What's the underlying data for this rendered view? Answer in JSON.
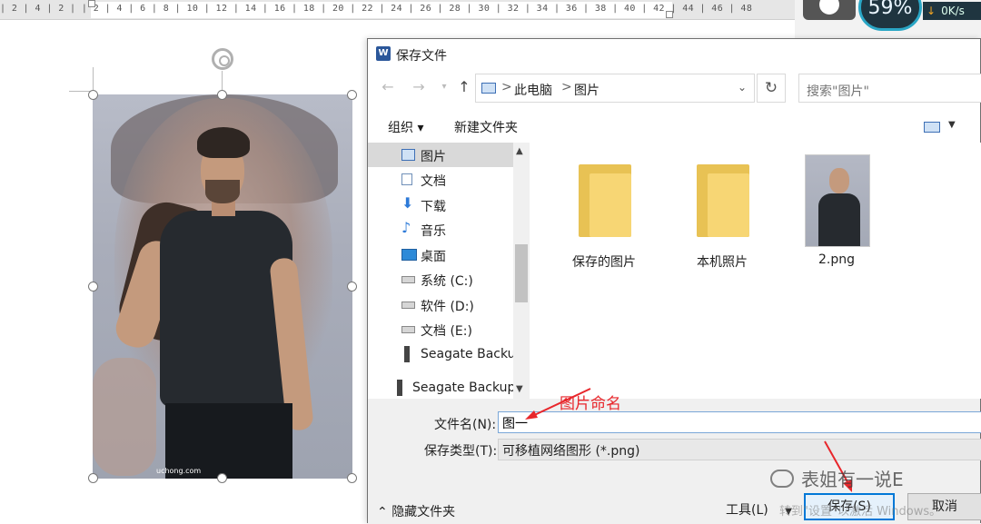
{
  "ruler": {
    "ticks": "| 2 | 4 | 2 | | 2 | 4 | 6 | 8 | 10 | 12 | 14 | 16 | 18 | 20 | 22 | 24 | 26 | 28 | 30 | 32 | 34 | 36 | 38 | 40 | 42 | 44 | 46 | 48"
  },
  "system_widget": {
    "percent": "59%",
    "speed": "0K/s"
  },
  "document": {
    "photo_credit": "uchong.com"
  },
  "dialog": {
    "title": "保存文件",
    "app_icon": "W",
    "address": {
      "segments": [
        "此电脑",
        "图片"
      ],
      "separator": ">"
    },
    "search_placeholder": "搜索\"图片\"",
    "toolbar": {
      "organize": "组织 ▾",
      "new_folder": "新建文件夹"
    },
    "nav_items": [
      {
        "label": "图片",
        "icon": "pictures-icon",
        "selected": true
      },
      {
        "label": "文档",
        "icon": "documents-icon",
        "selected": false
      },
      {
        "label": "下载",
        "icon": "download-icon",
        "selected": false
      },
      {
        "label": "音乐",
        "icon": "music-icon",
        "selected": false
      },
      {
        "label": "桌面",
        "icon": "desktop-icon",
        "selected": false
      },
      {
        "label": "系统 (C:)",
        "icon": "drive-icon",
        "selected": false
      },
      {
        "label": "软件 (D:)",
        "icon": "drive-icon",
        "selected": false
      },
      {
        "label": "文档 (E:)",
        "icon": "drive-icon",
        "selected": false
      },
      {
        "label": "Seagate Backup",
        "icon": "external-drive-icon",
        "selected": false
      },
      {
        "label": "Seagate Backup",
        "icon": "external-drive-icon",
        "selected": false
      }
    ],
    "files": [
      {
        "name": "保存的图片",
        "type": "folder"
      },
      {
        "name": "本机照片",
        "type": "folder"
      },
      {
        "name": "2.png",
        "type": "image"
      }
    ],
    "filename_label": "文件名(N):",
    "filename_value": "图一",
    "filetype_label": "保存类型(T):",
    "filetype_value": "可移植网络图形 (*.png)",
    "hide_folders": "隐藏文件夹",
    "tools": "工具(L)",
    "save": "保存(S)",
    "cancel": "取消"
  },
  "annotation": {
    "text": "图片命名",
    "color": "#e8262b"
  },
  "watermark": {
    "text": "表姐有一说E",
    "activate": "转到\"设置\"以激活 Windows。"
  }
}
